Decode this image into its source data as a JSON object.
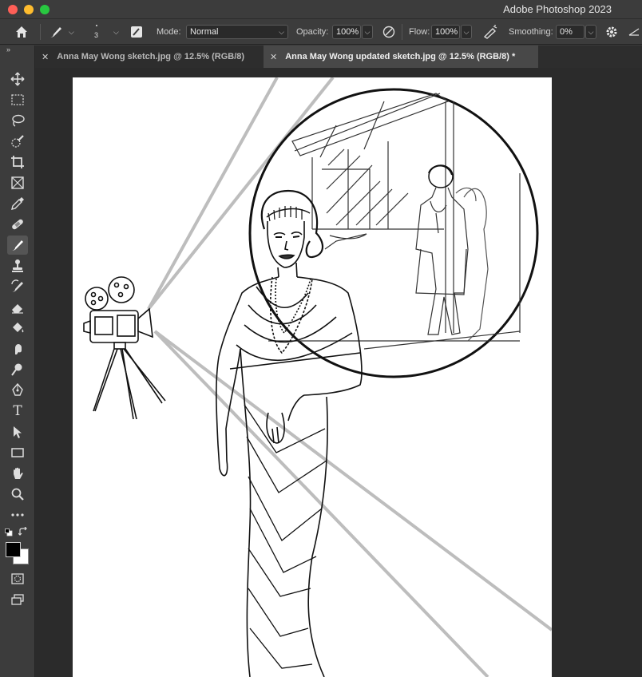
{
  "app": {
    "title": "Adobe Photoshop 2023"
  },
  "options_bar": {
    "brush_size": "3",
    "mode_label": "Mode:",
    "mode_value": "Normal",
    "opacity_label": "Opacity:",
    "opacity_value": "100%",
    "flow_label": "Flow:",
    "flow_value": "100%",
    "smoothing_label": "Smoothing:",
    "smoothing_value": "0%"
  },
  "tabs": [
    {
      "label": "Anna May Wong sketch.jpg @ 12.5% (RGB/8)",
      "active": false
    },
    {
      "label": "Anna May Wong updated sketch.jpg @ 12.5% (RGB/8) *",
      "active": true
    }
  ],
  "tools": [
    {
      "name": "move-tool",
      "icon": "move-icon"
    },
    {
      "name": "marquee-tool",
      "icon": "rectangle-marquee-icon"
    },
    {
      "name": "lasso-tool",
      "icon": "lasso-icon"
    },
    {
      "name": "quick-selection-tool",
      "icon": "quick-selection-icon"
    },
    {
      "name": "crop-tool",
      "icon": "crop-icon"
    },
    {
      "name": "frame-tool",
      "icon": "frame-icon"
    },
    {
      "name": "eyedropper-tool",
      "icon": "eyedropper-icon"
    },
    {
      "name": "healing-brush-tool",
      "icon": "bandage-icon"
    },
    {
      "name": "brush-tool",
      "icon": "brush-icon",
      "active": true
    },
    {
      "name": "clone-stamp-tool",
      "icon": "stamp-icon"
    },
    {
      "name": "history-brush-tool",
      "icon": "history-brush-icon"
    },
    {
      "name": "eraser-tool",
      "icon": "eraser-icon"
    },
    {
      "name": "paint-bucket-tool",
      "icon": "paint-bucket-icon"
    },
    {
      "name": "smudge-tool",
      "icon": "smudge-icon"
    },
    {
      "name": "dodge-tool",
      "icon": "dodge-icon"
    },
    {
      "name": "pen-tool",
      "icon": "pen-icon"
    },
    {
      "name": "type-tool",
      "icon": "type-icon"
    },
    {
      "name": "path-selection-tool",
      "icon": "arrow-icon"
    },
    {
      "name": "rectangle-tool",
      "icon": "rectangle-icon"
    },
    {
      "name": "hand-tool",
      "icon": "hand-icon"
    },
    {
      "name": "zoom-tool",
      "icon": "zoom-icon"
    },
    {
      "name": "more-tools",
      "icon": "ellipsis-icon"
    }
  ],
  "colors": {
    "foreground": "#000000",
    "background": "#ffffff",
    "canvas": "#ffffff",
    "workspace": "#2b2b2b"
  },
  "type_tool_glyph": "T"
}
